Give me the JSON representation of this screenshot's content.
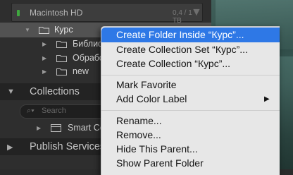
{
  "volume": {
    "name": "Macintosh HD",
    "size": "0,4 / 1 TB"
  },
  "folders": [
    {
      "label": "Курс",
      "selected": true
    },
    {
      "label": "Библис"
    },
    {
      "label": "Обрабс"
    },
    {
      "label": "new"
    }
  ],
  "collections": {
    "title": "Collections",
    "search_placeholder": "Search",
    "items": [
      {
        "label": "Smart Co"
      }
    ]
  },
  "publish_services": {
    "title": "Publish Services"
  },
  "context_menu": {
    "items": [
      {
        "label": "Create Folder Inside “Курс”...",
        "highlighted": true
      },
      {
        "label": "Create Collection Set “Курс”..."
      },
      {
        "label": "Create Collection “Курс”..."
      },
      {
        "label": "Mark Favorite"
      },
      {
        "label": "Add Color Label",
        "has_submenu": true
      },
      {
        "label": "Rename..."
      },
      {
        "label": "Remove..."
      },
      {
        "label": "Hide This Parent..."
      },
      {
        "label": "Show Parent Folder"
      }
    ]
  },
  "colors": {
    "panel_bg": "#2e2e2e",
    "selected_row": "#525252",
    "menu_bg": "#e7e7e7",
    "menu_highlight": "#2e78e6",
    "volume_led": "#3fa83f"
  },
  "icons": {
    "folder": "folder-icon",
    "disclosure": "triangle-icon",
    "search": "search-icon",
    "submenu": "chevron-right-icon"
  }
}
